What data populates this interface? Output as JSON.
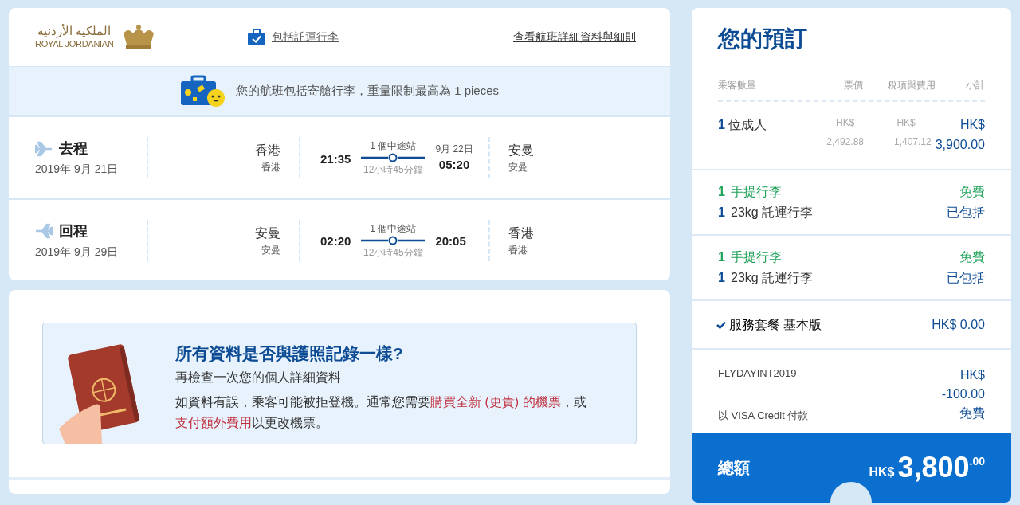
{
  "header": {
    "logo": {
      "arabic": "الملكية الأردنية",
      "latin": "ROYAL JORDANIAN"
    },
    "baggage_link": "包括託運行李",
    "details_link": "查看航班詳細資料與細則"
  },
  "banner": {
    "text": "您的航班包括寄艙行李，重量限制最高為 1 pieces"
  },
  "flights": [
    {
      "label": "去程",
      "date": "2019年 9月 21日",
      "from_city": "香港",
      "from_sub": "香港",
      "depart": "21:35",
      "stops": "1 個中途站",
      "duration": "12小時45分鐘",
      "arrive": "05:20",
      "arrive_date": "9月 22日",
      "to_city": "安曼",
      "to_sub": "安曼",
      "kind": "outbound"
    },
    {
      "label": "回程",
      "date": "2019年 9月 29日",
      "from_city": "安曼",
      "from_sub": "安曼",
      "depart": "02:20",
      "stops": "1 個中途站",
      "duration": "12小時45分鐘",
      "arrive": "20:05",
      "to_city": "香港",
      "to_sub": "香港",
      "kind": "return"
    }
  ],
  "notice": {
    "title": "所有資料是否與護照記錄一樣?",
    "subtitle": "再檢查一次您的個人詳細資料",
    "body": [
      {
        "text": "如資料有誤，乘客可能被拒登機。通常您需要",
        "kind": "plain"
      },
      {
        "text": "購買全新 (更貴) 的機票",
        "kind": "link"
      },
      {
        "text": "，或",
        "kind": "plain"
      },
      {
        "text": "支付額外費用",
        "kind": "link"
      },
      {
        "text": "以更改機票。",
        "kind": "plain"
      }
    ]
  },
  "booking": {
    "title": "您的預訂",
    "columns": [
      "乘客數量",
      "票價",
      "稅項與費用",
      "小計"
    ],
    "passenger": {
      "count": "1",
      "label": "位成人",
      "fare_currency": "HK$",
      "fare": "2,492.88",
      "tax_currency": "HK$",
      "tax": "1,407.12",
      "subtotal_currency": "HK$",
      "subtotal": "3,900.00"
    },
    "baggage_groups": [
      {
        "items": [
          {
            "kind": "cabin",
            "count": "1",
            "label": "手提行李",
            "price": "免費"
          },
          {
            "kind": "checked",
            "count": "1",
            "label": "23kg 託運行李",
            "price": "已包括"
          }
        ]
      },
      {
        "items": [
          {
            "kind": "cabin",
            "count": "1",
            "label": "手提行李",
            "price": "免費"
          },
          {
            "kind": "checked",
            "count": "1",
            "label": "23kg 託運行李",
            "price": "已包括"
          }
        ]
      }
    ],
    "service": {
      "checked": true,
      "label": "服務套餐 基本版",
      "price": "HK$ 0.00"
    },
    "promo": {
      "code": "FLYDAYINT2019",
      "currency": "HK$",
      "amount": "-100.00"
    },
    "payment": {
      "label": "以 VISA Credit 付款",
      "price": "免費"
    },
    "total": {
      "label": "總額",
      "currency": "HK$",
      "amount": "3,800",
      "cents": ".00"
    }
  }
}
